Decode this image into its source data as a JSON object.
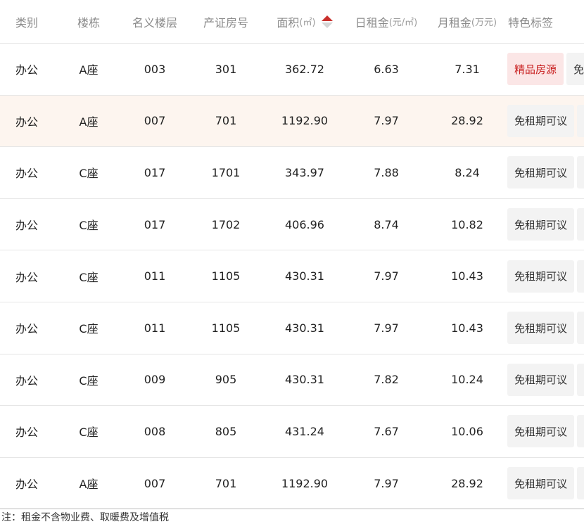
{
  "headers": {
    "category": "类别",
    "building": "楼栋",
    "floor": "名义楼层",
    "room": "产证房号",
    "area": "面积",
    "area_unit": "(㎡)",
    "daily_rent": "日租金",
    "daily_rent_unit": "(元/㎡)",
    "monthly_rent": "月租金",
    "monthly_rent_unit": "(万元)",
    "tags": "特色标签"
  },
  "colors": {
    "sort_active": "#c9302c",
    "sort_inactive": "#d5d5d5",
    "premium_tag_bg": "#fbe6e6",
    "premium_tag_text": "#c81e1e",
    "highlight_row": "#fdf5ef"
  },
  "rows": [
    {
      "category": "办公",
      "building": "A座",
      "floor": "003",
      "room": "301",
      "area": "362.72",
      "daily": "6.63",
      "monthly": "7.31",
      "tag1": "精品房源",
      "tag1_type": "premium",
      "tag2": "免"
    },
    {
      "category": "办公",
      "building": "A座",
      "floor": "007",
      "room": "701",
      "area": "1192.90",
      "daily": "7.97",
      "monthly": "28.92",
      "tag1": "免租期可议",
      "tag1_type": "normal",
      "tag2": ""
    },
    {
      "category": "办公",
      "building": "C座",
      "floor": "017",
      "room": "1701",
      "area": "343.97",
      "daily": "7.88",
      "monthly": "8.24",
      "tag1": "免租期可议",
      "tag1_type": "normal",
      "tag2": ""
    },
    {
      "category": "办公",
      "building": "C座",
      "floor": "017",
      "room": "1702",
      "area": "406.96",
      "daily": "8.74",
      "monthly": "10.82",
      "tag1": "免租期可议",
      "tag1_type": "normal",
      "tag2": ""
    },
    {
      "category": "办公",
      "building": "C座",
      "floor": "011",
      "room": "1105",
      "area": "430.31",
      "daily": "7.97",
      "monthly": "10.43",
      "tag1": "免租期可议",
      "tag1_type": "normal",
      "tag2": ""
    },
    {
      "category": "办公",
      "building": "C座",
      "floor": "011",
      "room": "1105",
      "area": "430.31",
      "daily": "7.97",
      "monthly": "10.43",
      "tag1": "免租期可议",
      "tag1_type": "normal",
      "tag2": ""
    },
    {
      "category": "办公",
      "building": "C座",
      "floor": "009",
      "room": "905",
      "area": "430.31",
      "daily": "7.82",
      "monthly": "10.24",
      "tag1": "免租期可议",
      "tag1_type": "normal",
      "tag2": ""
    },
    {
      "category": "办公",
      "building": "C座",
      "floor": "008",
      "room": "805",
      "area": "431.24",
      "daily": "7.67",
      "monthly": "10.06",
      "tag1": "免租期可议",
      "tag1_type": "normal",
      "tag2": ""
    },
    {
      "category": "办公",
      "building": "A座",
      "floor": "007",
      "room": "701",
      "area": "1192.90",
      "daily": "7.97",
      "monthly": "28.92",
      "tag1": "免租期可议",
      "tag1_type": "normal",
      "tag2": ""
    }
  ],
  "note": "注：租金不含物业费、取暖费及增值税"
}
